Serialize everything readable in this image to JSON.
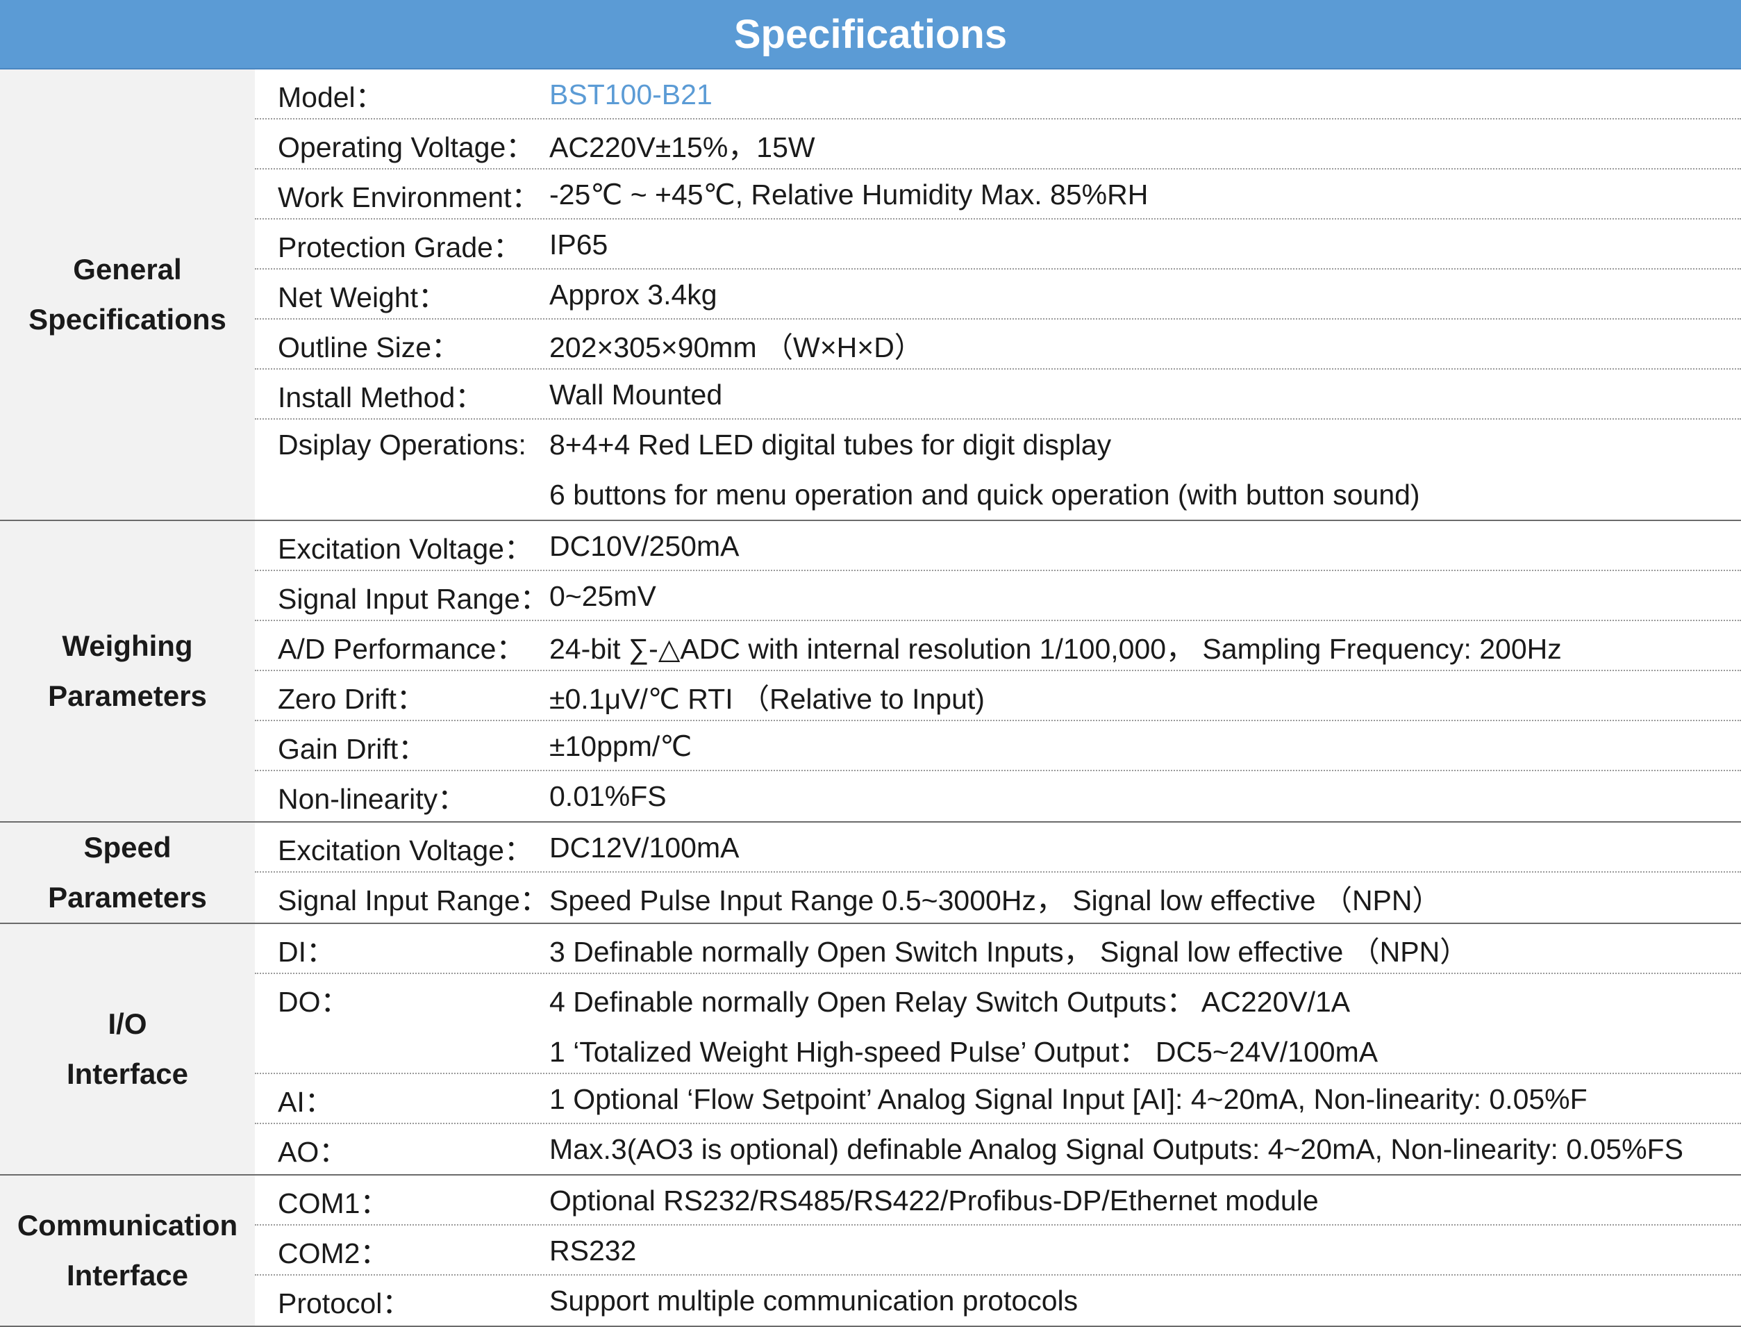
{
  "title": "Specifications",
  "accent_color": "#5b9bd5",
  "sections": [
    {
      "category": [
        "General",
        "Specifications"
      ],
      "rows": [
        {
          "label": "Model：",
          "values": [
            "BST100-B21"
          ],
          "accent": true
        },
        {
          "label": "Operating Voltage：",
          "values": [
            "AC220V±15%，15W"
          ]
        },
        {
          "label": "Work Environment：",
          "values": [
            "-25℃ ~ +45℃, Relative Humidity Max. 85%RH"
          ]
        },
        {
          "label": "Protection Grade：",
          "values": [
            "IP65"
          ]
        },
        {
          "label": "Net Weight：",
          "values": [
            "Approx  3.4kg"
          ]
        },
        {
          "label": "Outline Size：",
          "values": [
            "202×305×90mm （W×H×D）"
          ]
        },
        {
          "label": "Install Method：",
          "values": [
            "Wall Mounted"
          ]
        },
        {
          "label": "Dsiplay Operations:",
          "values": [
            "8+4+4 Red LED digital tubes for digit display",
            "6 buttons for menu operation and quick operation (with button sound)"
          ]
        }
      ]
    },
    {
      "category": [
        "Weighing",
        "Parameters"
      ],
      "rows": [
        {
          "label": "Excitation Voltage：",
          "values": [
            "DC10V/250mA"
          ]
        },
        {
          "label": "Signal Input Range：",
          "values": [
            "0~25mV"
          ]
        },
        {
          "label": "A/D Performance：",
          "values": [
            "24-bit ∑-△ADC with internal resolution 1/100,000， Sampling Frequency: 200Hz"
          ]
        },
        {
          "label": "Zero Drift：",
          "values": [
            "±0.1μV/℃ RTI （Relative to Input)"
          ]
        },
        {
          "label": "Gain Drift：",
          "values": [
            "±10ppm/℃"
          ]
        },
        {
          "label": "Non-linearity：",
          "values": [
            "0.01%FS"
          ]
        }
      ]
    },
    {
      "category": [
        "Speed",
        "Parameters"
      ],
      "rows": [
        {
          "label": "Excitation Voltage：",
          "values": [
            "DC12V/100mA"
          ]
        },
        {
          "label": "Signal Input Range：",
          "values": [
            "Speed Pulse Input Range  0.5~3000Hz， Signal low effective （NPN）"
          ]
        }
      ]
    },
    {
      "category": [
        "I/O",
        "Interface"
      ],
      "rows": [
        {
          "label": "DI：",
          "values": [
            "3 Definable normally Open Switch Inputs， Signal low effective （NPN）"
          ]
        },
        {
          "label": "DO：",
          "values": [
            "4 Definable normally Open Relay Switch Outputs： AC220V/1A",
            "1 ‘Totalized Weight High-speed Pulse’ Output： DC5~24V/100mA"
          ]
        },
        {
          "label": "AI：",
          "values": [
            "1 Optional ‘Flow Setpoint’ Analog Signal Input [AI]: 4~20mA, Non-linearity: 0.05%F"
          ]
        },
        {
          "label": "AO：",
          "values": [
            "Max.3(AO3 is optional) definable Analog Signal Outputs: 4~20mA, Non-linearity: 0.05%FS"
          ]
        }
      ]
    },
    {
      "category": [
        "Communication",
        "Interface"
      ],
      "rows": [
        {
          "label": "COM1：",
          "values": [
            "Optional RS232/RS485/RS422/Profibus-DP/Ethernet module"
          ]
        },
        {
          "label": "COM2：",
          "values": [
            "RS232"
          ]
        },
        {
          "label": "Protocol：",
          "values": [
            "Support multiple communication protocols"
          ]
        }
      ]
    }
  ]
}
